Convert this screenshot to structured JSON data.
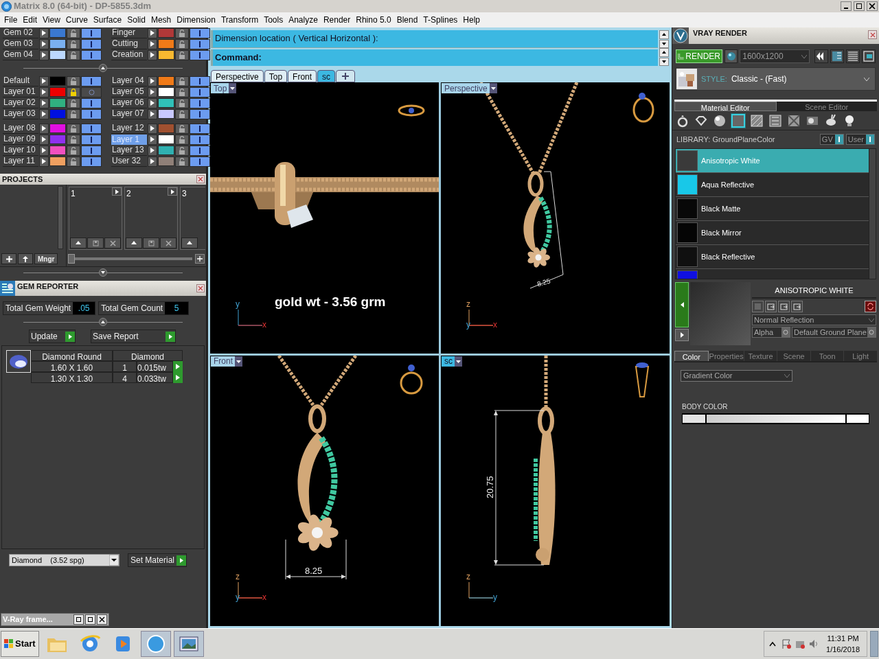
{
  "window": {
    "title": "Matrix 8.0 (64-bit) - DP-5855.3dm"
  },
  "menu": [
    "File",
    "Edit",
    "View",
    "Curve",
    "Surface",
    "Solid",
    "Mesh",
    "Dimension",
    "Transform",
    "Tools",
    "Analyze",
    "Render",
    "Rhino 5.0",
    "Blend",
    "T-Splines",
    "Help"
  ],
  "layer_groups": [
    {
      "left": [
        {
          "name": "Gem 02",
          "color": "#3a78d0",
          "locked": false,
          "on": true,
          "selected": false
        },
        {
          "name": "Gem 03",
          "color": "#7ab0f0",
          "locked": false,
          "on": true,
          "selected": false
        },
        {
          "name": "Gem 04",
          "color": "#bcd8ff",
          "locked": false,
          "on": true,
          "selected": false
        }
      ],
      "right": [
        {
          "name": "Finger",
          "color": "#b03838",
          "locked": false,
          "on": true,
          "selected": false
        },
        {
          "name": "Cutting",
          "color": "#f07a18",
          "locked": false,
          "on": true,
          "selected": false
        },
        {
          "name": "Creation",
          "color": "#f8b830",
          "locked": false,
          "on": true,
          "selected": false
        }
      ]
    },
    {
      "left": [
        {
          "name": "Default",
          "color": "#000000",
          "locked": false,
          "on": true,
          "selected": false
        },
        {
          "name": "Layer 01",
          "color": "#ee0000",
          "locked": true,
          "on": false,
          "selected": false
        },
        {
          "name": "Layer 02",
          "color": "#30b080",
          "locked": false,
          "on": true,
          "selected": false
        },
        {
          "name": "Layer 03",
          "color": "#0010e0",
          "locked": false,
          "on": true,
          "selected": false
        }
      ],
      "right": [
        {
          "name": "Layer 04",
          "color": "#f07a18",
          "locked": false,
          "on": true,
          "selected": false
        },
        {
          "name": "Layer 05",
          "color": "#ffffff",
          "locked": false,
          "on": true,
          "selected": false
        },
        {
          "name": "Layer 06",
          "color": "#30c0b8",
          "locked": false,
          "on": true,
          "selected": false
        },
        {
          "name": "Layer 07",
          "color": "#c8c8ff",
          "locked": false,
          "on": true,
          "selected": false
        }
      ]
    },
    {
      "left": [
        {
          "name": "Layer 08",
          "color": "#e010e0",
          "locked": false,
          "on": true,
          "selected": false
        },
        {
          "name": "Layer 09",
          "color": "#9030f0",
          "locked": false,
          "on": true,
          "selected": false
        },
        {
          "name": "Layer 10",
          "color": "#f050c0",
          "locked": false,
          "on": true,
          "selected": false
        },
        {
          "name": "Layer 11",
          "color": "#f0a060",
          "locked": false,
          "on": true,
          "selected": false
        }
      ],
      "right": [
        {
          "name": "Layer 12",
          "color": "#a05030",
          "locked": false,
          "on": true,
          "selected": false
        },
        {
          "name": "Layer 1",
          "color": "#ffffff",
          "locked": false,
          "on": true,
          "selected": true
        },
        {
          "name": "Layer 13",
          "color": "#30b0b0",
          "locked": false,
          "on": true,
          "selected": false
        },
        {
          "name": "User 32",
          "color": "#908078",
          "locked": false,
          "on": true,
          "selected": false
        }
      ]
    }
  ],
  "projects": {
    "title": "PROJECTS",
    "slots": [
      "1",
      "2",
      "3"
    ],
    "manager_button": "Mngr",
    "level": 0
  },
  "gem_reporter": {
    "title": "GEM REPORTER",
    "weight_label": "Total Gem Weight",
    "weight": ".05",
    "count_label": "Total Gem Count",
    "count": "5",
    "buttons": [
      "Update",
      "Save Report"
    ],
    "columns": [
      "Diamond Round",
      "Diamond"
    ],
    "rows": [
      {
        "size": "1.60 X 1.60",
        "count": "1",
        "weight": "0.015tw"
      },
      {
        "size": "1.30 X 1.30",
        "count": "4",
        "weight": "0.033tw"
      }
    ],
    "material": "Diamond    (3.52 spg)",
    "set_material": "Set Material"
  },
  "minimized_window": {
    "title": "V-Ray frame..."
  },
  "command": {
    "history": "Dimension location ( Vertical  Horizontal ):",
    "prompt": "Command:"
  },
  "view_tabs": [
    {
      "label": "Perspective",
      "selected": false
    },
    {
      "label": "Top",
      "selected": false
    },
    {
      "label": "Front",
      "selected": false
    },
    {
      "label": "sc",
      "selected": true
    }
  ],
  "viewports": [
    {
      "kind": "top",
      "label": "Top",
      "axes": [
        "y",
        "x"
      ],
      "note": "gold wt - 3.56 grm"
    },
    {
      "kind": "perspective",
      "label": "Perspective",
      "axes": [
        "z",
        "y",
        "x"
      ],
      "dimension": "8.25"
    },
    {
      "kind": "front",
      "label": "Front",
      "axes": [
        "z",
        "y",
        "x"
      ],
      "dimension": "8.25"
    },
    {
      "kind": "side",
      "label": "sc",
      "axes": [
        "z",
        "y"
      ],
      "dimension": "20.75"
    }
  ],
  "vray": {
    "title": "VRAY RENDER",
    "render_button": "RENDER",
    "resolution": "1600x1200",
    "style_label": "STYLE:",
    "style": "Classic - (Fast)",
    "tabs": [
      {
        "label": "Material Editor",
        "selected": true
      },
      {
        "label": "Scene Editor",
        "selected": false
      }
    ],
    "library": "LIBRARY: GroundPlaneColor",
    "toggles": [
      "GV",
      "User"
    ],
    "materials": [
      {
        "name": "Anisotropic White",
        "color": "#3a3a3a",
        "selected": true
      },
      {
        "name": "Aqua Reflective",
        "color": "#18c8e8",
        "selected": false
      },
      {
        "name": "Black Matte",
        "color": "#080808",
        "selected": false
      },
      {
        "name": "Black Mirror",
        "color": "#050505",
        "selected": false
      },
      {
        "name": "Black Reflective",
        "color": "#101010",
        "selected": false
      },
      {
        "color": "#1010e0",
        "selected": false
      }
    ],
    "material_title": "ANISOTROPIC WHITE",
    "reflection": "Normal Reflection",
    "alpha": "Alpha",
    "ground": "Default Ground Plane",
    "prop_tabs": [
      {
        "label": "Color",
        "selected": true
      },
      {
        "label": "Properties",
        "selected": false
      },
      {
        "label": "Texture",
        "selected": false
      },
      {
        "label": "Scene",
        "selected": false
      },
      {
        "label": "Toon",
        "selected": false
      },
      {
        "label": "Light",
        "selected": false
      }
    ],
    "color_mode": "Gradient Color",
    "body_color_label": "BODY COLOR"
  },
  "taskbar": {
    "start": "Start",
    "time": "11:31 PM",
    "date": "1/16/2018"
  }
}
